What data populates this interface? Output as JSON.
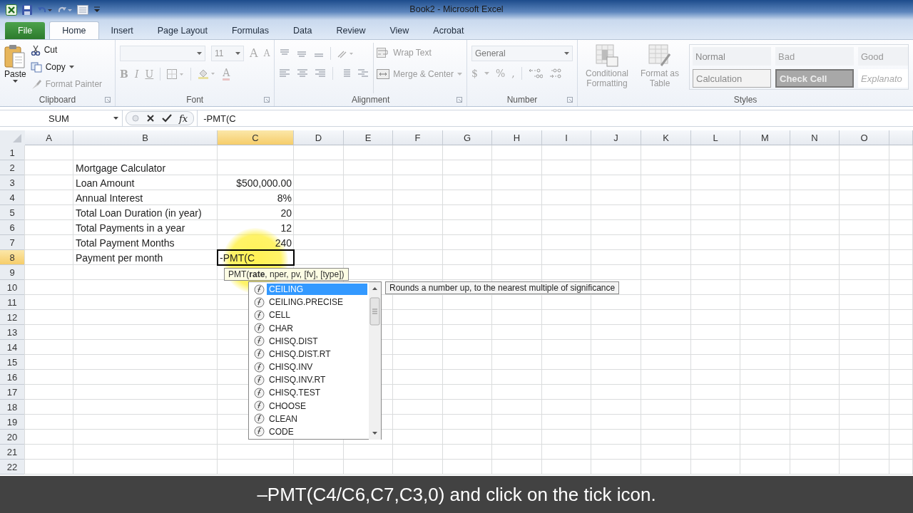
{
  "title_bar": {
    "title": "Book2  -  Microsoft Excel"
  },
  "tabs": [
    {
      "label": "File",
      "kind": "file",
      "selected": false
    },
    {
      "label": "Home",
      "kind": "tab",
      "selected": true
    },
    {
      "label": "Insert",
      "kind": "tab",
      "selected": false
    },
    {
      "label": "Page Layout",
      "kind": "tab",
      "selected": false
    },
    {
      "label": "Formulas",
      "kind": "tab",
      "selected": false
    },
    {
      "label": "Data",
      "kind": "tab",
      "selected": false
    },
    {
      "label": "Review",
      "kind": "tab",
      "selected": false
    },
    {
      "label": "View",
      "kind": "tab",
      "selected": false
    },
    {
      "label": "Acrobat",
      "kind": "tab",
      "selected": false
    }
  ],
  "ribbon": {
    "clipboard": {
      "label": "Clipboard",
      "paste": "Paste",
      "cut": "Cut",
      "copy": "Copy",
      "format_painter": "Format Painter"
    },
    "font": {
      "label": "Font",
      "size": "11",
      "grow": "A",
      "shrink": "A",
      "bold": "B",
      "italic": "I",
      "underline": "U",
      "font_color": "A"
    },
    "alignment": {
      "label": "Alignment",
      "wrap_text": "Wrap Text",
      "merge_center": "Merge & Center"
    },
    "number": {
      "label": "Number",
      "format": "General",
      "currency": "$",
      "percent": "%",
      "comma": ","
    },
    "styles": {
      "label": "Styles",
      "conditional_formatting": "Conditional Formatting",
      "format_as_table": "Format as Table",
      "cell_styles": [
        {
          "label": "Normal",
          "kind": "normal"
        },
        {
          "label": "Bad",
          "kind": "bad"
        },
        {
          "label": "Good",
          "kind": "good"
        },
        {
          "label": "Calculation",
          "kind": "calculation"
        },
        {
          "label": "Check Cell",
          "kind": "check"
        },
        {
          "label": "Explanato",
          "kind": "explanatory"
        }
      ]
    }
  },
  "formula_bar": {
    "name_box": "SUM",
    "function_button": "fx",
    "formula": "-PMT(C"
  },
  "sheet": {
    "columns": [
      {
        "label": "A",
        "selected": false
      },
      {
        "label": "B",
        "selected": false
      },
      {
        "label": "C",
        "selected": true
      },
      {
        "label": "D",
        "selected": false
      },
      {
        "label": "E",
        "selected": false
      },
      {
        "label": "F",
        "selected": false
      },
      {
        "label": "G",
        "selected": false
      },
      {
        "label": "H",
        "selected": false
      },
      {
        "label": "I",
        "selected": false
      },
      {
        "label": "J",
        "selected": false
      },
      {
        "label": "K",
        "selected": false
      },
      {
        "label": "L",
        "selected": false
      },
      {
        "label": "M",
        "selected": false
      },
      {
        "label": "N",
        "selected": false
      },
      {
        "label": "O",
        "selected": false
      }
    ],
    "rows": [
      {
        "number": "1",
        "selected": false
      },
      {
        "number": "2",
        "selected": false,
        "b": "Mortgage Calculator"
      },
      {
        "number": "3",
        "selected": false,
        "b": "Loan Amount",
        "c": "$500,000.00"
      },
      {
        "number": "4",
        "selected": false,
        "b": "Annual Interest",
        "c": "8%"
      },
      {
        "number": "5",
        "selected": false,
        "b": "Total Loan Duration (in year)",
        "c": "20"
      },
      {
        "number": "6",
        "selected": false,
        "b": "Total Payments in a year",
        "c": "12"
      },
      {
        "number": "7",
        "selected": false,
        "b": "Total Payment Months",
        "c": "240"
      },
      {
        "number": "8",
        "selected": true,
        "b": "Payment per month",
        "c": "-PMT(C"
      },
      {
        "number": "9",
        "selected": false
      },
      {
        "number": "10",
        "selected": false
      },
      {
        "number": "11",
        "selected": false
      },
      {
        "number": "12",
        "selected": false
      },
      {
        "number": "13",
        "selected": false
      },
      {
        "number": "14",
        "selected": false
      },
      {
        "number": "15",
        "selected": false
      },
      {
        "number": "16",
        "selected": false
      },
      {
        "number": "17",
        "selected": false
      },
      {
        "number": "18",
        "selected": false
      },
      {
        "number": "19",
        "selected": false
      },
      {
        "number": "20",
        "selected": false
      },
      {
        "number": "21",
        "selected": false
      },
      {
        "number": "22",
        "selected": false
      }
    ]
  },
  "function_tooltip": "PMT(**rate**, nper, pv, [fv], [type])",
  "autocomplete": {
    "items": [
      {
        "label": "CEILING",
        "selected": true
      },
      {
        "label": "CEILING.PRECISE",
        "selected": false
      },
      {
        "label": "CELL",
        "selected": false
      },
      {
        "label": "CHAR",
        "selected": false
      },
      {
        "label": "CHISQ.DIST",
        "selected": false
      },
      {
        "label": "CHISQ.DIST.RT",
        "selected": false
      },
      {
        "label": "CHISQ.INV",
        "selected": false
      },
      {
        "label": "CHISQ.INV.RT",
        "selected": false
      },
      {
        "label": "CHISQ.TEST",
        "selected": false
      },
      {
        "label": "CHOOSE",
        "selected": false
      },
      {
        "label": "CLEAN",
        "selected": false
      },
      {
        "label": "CODE",
        "selected": false
      }
    ],
    "description": "Rounds a number up, to the nearest multiple of significance"
  },
  "caption": "–PMT(C4/C6,C7,C3,0) and click on the tick icon."
}
